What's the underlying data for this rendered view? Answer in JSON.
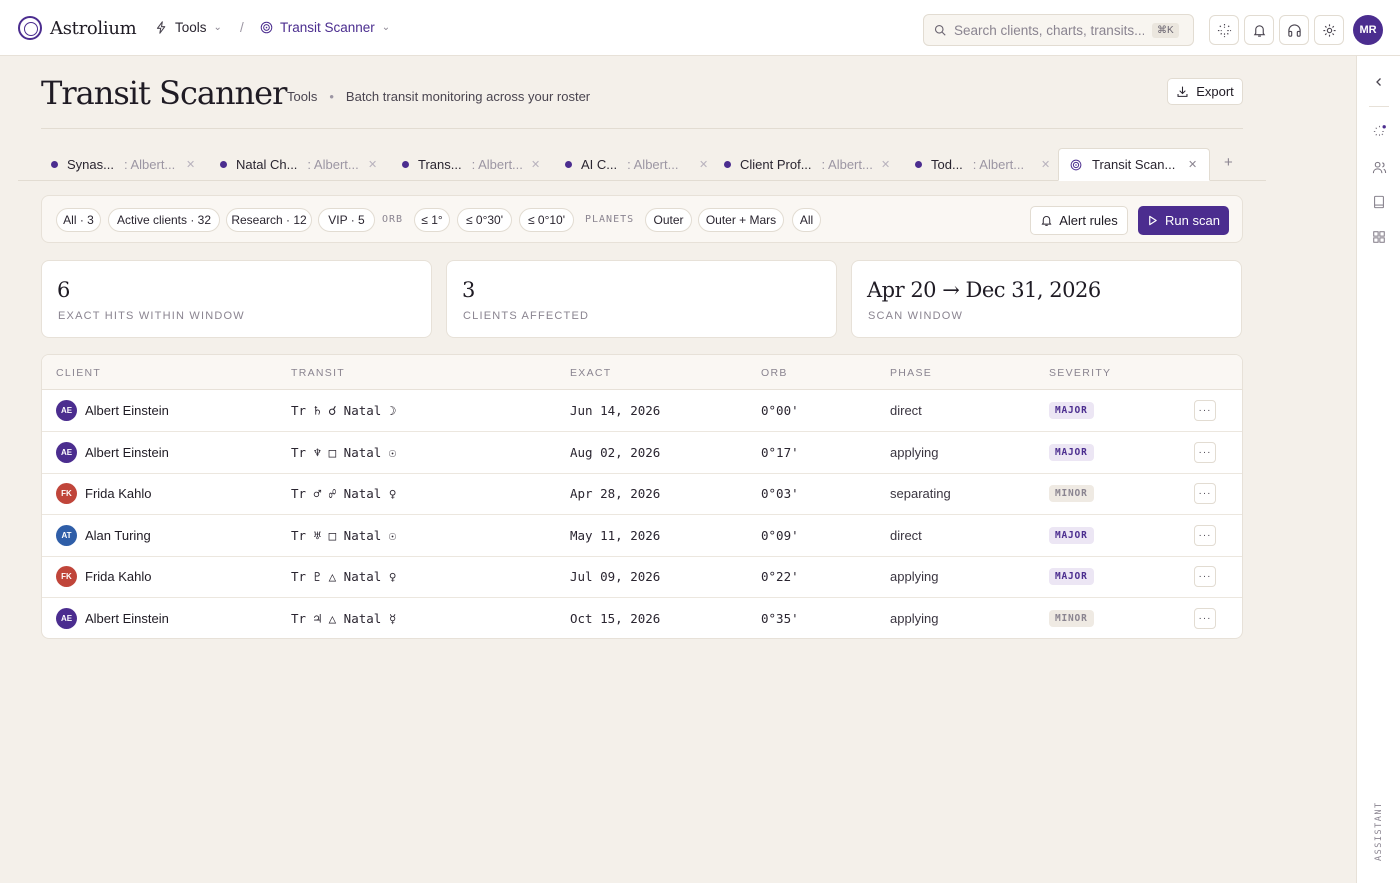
{
  "app": {
    "name": "Astrolium"
  },
  "breadcrumb": {
    "section": "Tools",
    "current": "Transit Scanner"
  },
  "search": {
    "placeholder": "Search clients, charts, transits...",
    "shortcut": "⌘K"
  },
  "user": {
    "initials": "MR"
  },
  "header": {
    "title": "Transit Scanner",
    "section": "Tools",
    "description": "Batch transit monitoring across your roster",
    "export_label": "Export"
  },
  "tabs": [
    {
      "name": "Synas...",
      "sub": ": Albert..."
    },
    {
      "name": "Natal Ch...",
      "sub": ": Albert..."
    },
    {
      "name": "Trans...",
      "sub": ": Albert..."
    },
    {
      "name": "AI C...",
      "sub": ": Albert..."
    },
    {
      "name": "Client Prof...",
      "sub": ": Albert..."
    },
    {
      "name": "Tod...",
      "sub": ": Albert..."
    },
    {
      "name": "Transit Scan..."
    }
  ],
  "filters": {
    "groups": [
      "All · 3",
      "Active clients · 32",
      "Research · 12",
      "VIP · 5"
    ],
    "orb_label": "ORB",
    "orbs": [
      "≤ 1°",
      "≤ 0°30'",
      "≤ 0°10'"
    ],
    "planets_label": "PLANETS",
    "planets": [
      "Outer",
      "Outer + Mars",
      "All"
    ],
    "alert_rules_label": "Alert rules",
    "run_scan_label": "Run scan"
  },
  "stats": [
    {
      "value": "6",
      "label": "EXACT HITS WITHIN WINDOW"
    },
    {
      "value": "3",
      "label": "CLIENTS AFFECTED"
    },
    {
      "value": "Apr 20 → Dec 31, 2026",
      "label": "SCAN WINDOW"
    }
  ],
  "table": {
    "columns": [
      "CLIENT",
      "TRANSIT",
      "EXACT",
      "ORB",
      "PHASE",
      "SEVERITY"
    ],
    "rows": [
      {
        "initials": "AE",
        "client": "Albert Einstein",
        "transit": "Tr ♄ ☌ Natal ☽",
        "exact": "Jun 14, 2026",
        "orb": "0°00'",
        "phase": "direct",
        "severity": "MAJOR"
      },
      {
        "initials": "AE",
        "client": "Albert Einstein",
        "transit": "Tr ♆ □ Natal ☉",
        "exact": "Aug 02, 2026",
        "orb": "0°17'",
        "phase": "applying",
        "severity": "MAJOR"
      },
      {
        "initials": "FK",
        "client": "Frida Kahlo",
        "transit": "Tr ♂ ☍ Natal ♀",
        "exact": "Apr 28, 2026",
        "orb": "0°03'",
        "phase": "separating",
        "severity": "MINOR"
      },
      {
        "initials": "AT",
        "client": "Alan Turing",
        "transit": "Tr ♅ □ Natal ☉",
        "exact": "May 11, 2026",
        "orb": "0°09'",
        "phase": "direct",
        "severity": "MAJOR"
      },
      {
        "initials": "FK",
        "client": "Frida Kahlo",
        "transit": "Tr ♇ △ Natal ♀",
        "exact": "Jul 09, 2026",
        "orb": "0°22'",
        "phase": "applying",
        "severity": "MAJOR"
      },
      {
        "initials": "AE",
        "client": "Albert Einstein",
        "transit": "Tr ♃ △ Natal ☿",
        "exact": "Oct 15, 2026",
        "orb": "0°35'",
        "phase": "applying",
        "severity": "MINOR"
      }
    ],
    "row_action": "···"
  },
  "assistant": {
    "label": "ASSISTANT"
  },
  "colors": {
    "accent": "#4b2d8f",
    "avatar_ae": "#4b2d8f",
    "avatar_fk": "#c0453a",
    "avatar_at": "#2f5ea8"
  }
}
